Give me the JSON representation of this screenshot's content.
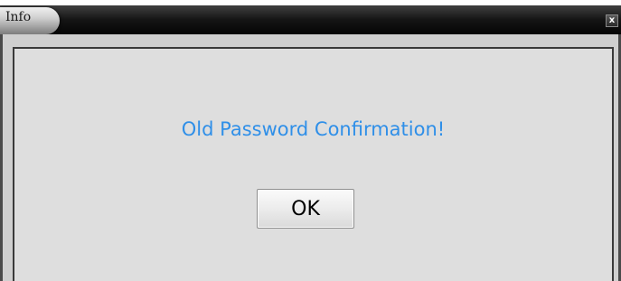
{
  "dialog": {
    "title": "Info",
    "close_label": "x",
    "message": "Old Password Confirmation!",
    "ok_label": "OK"
  },
  "colors": {
    "message_text": "#2f8fe8",
    "titlebar": "#101010",
    "dialog_background": "#dedede"
  }
}
